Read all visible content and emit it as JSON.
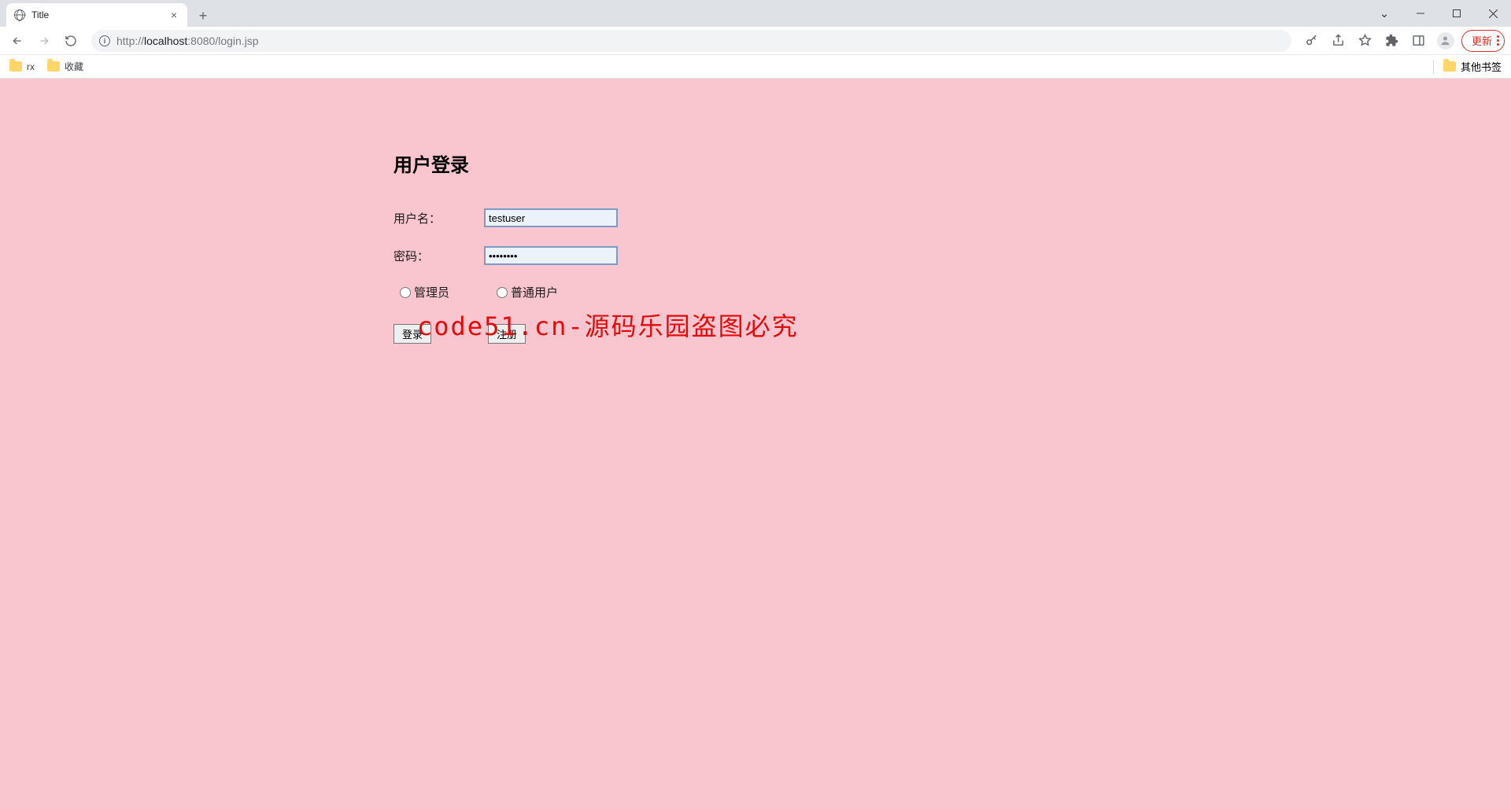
{
  "browser": {
    "tab_title": "Title",
    "url_protocol": "http://",
    "url_host": "localhost",
    "url_port_path": ":8080/login.jsp",
    "update_label": "更新"
  },
  "bookmarks": {
    "items": [
      "rx",
      "收藏"
    ],
    "right": "其他书签"
  },
  "page": {
    "heading": "用户登录",
    "username_label": "用户名：",
    "username_value": "testuser",
    "password_label": "密码：",
    "password_value": "••••••••",
    "role_admin": "管理员",
    "role_user": "普通用户",
    "login_btn": "登录",
    "register_btn": "注册"
  },
  "watermark": "code51.cn-源码乐园盗图必究"
}
